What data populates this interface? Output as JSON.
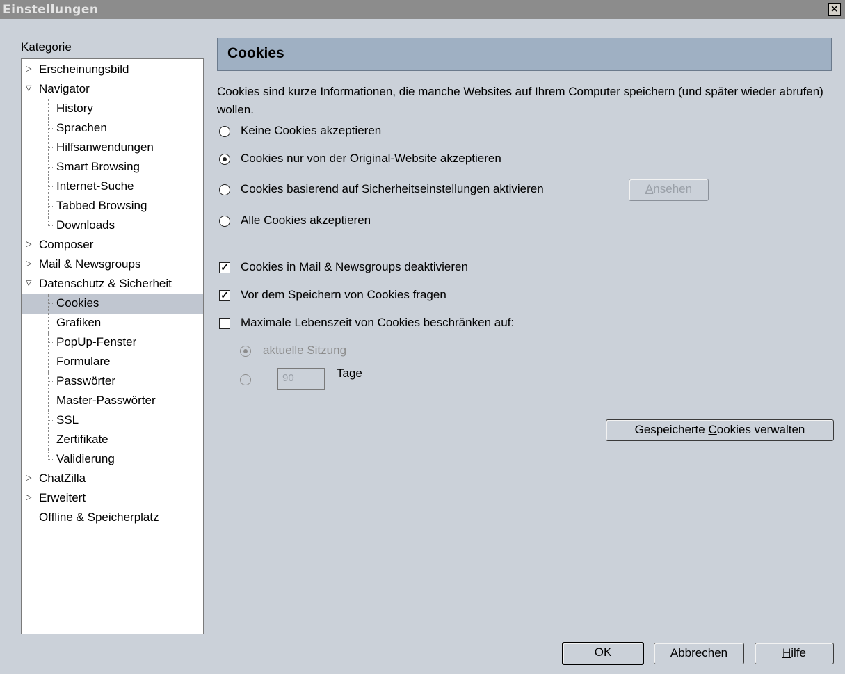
{
  "window": {
    "title": "Einstellungen",
    "close_glyph": "×"
  },
  "sidebar": {
    "label": "Kategorie",
    "items": [
      {
        "label": "Erscheinungsbild",
        "level": 0,
        "twisty": "closed"
      },
      {
        "label": "Navigator",
        "level": 0,
        "twisty": "open"
      },
      {
        "label": "History",
        "level": 1
      },
      {
        "label": "Sprachen",
        "level": 1
      },
      {
        "label": "Hilfsanwendungen",
        "level": 1
      },
      {
        "label": "Smart Browsing",
        "level": 1
      },
      {
        "label": "Internet-Suche",
        "level": 1
      },
      {
        "label": "Tabbed Browsing",
        "level": 1
      },
      {
        "label": "Downloads",
        "level": 1
      },
      {
        "label": "Composer",
        "level": 0,
        "twisty": "closed"
      },
      {
        "label": "Mail & Newsgroups",
        "level": 0,
        "twisty": "closed"
      },
      {
        "label": "Datenschutz & Sicherheit",
        "level": 0,
        "twisty": "open"
      },
      {
        "label": "Cookies",
        "level": 1,
        "selected": true
      },
      {
        "label": "Grafiken",
        "level": 1
      },
      {
        "label": "PopUp-Fenster",
        "level": 1
      },
      {
        "label": "Formulare",
        "level": 1
      },
      {
        "label": "Passwörter",
        "level": 1
      },
      {
        "label": "Master-Passwörter",
        "level": 1
      },
      {
        "label": "SSL",
        "level": 1
      },
      {
        "label": "Zertifikate",
        "level": 1
      },
      {
        "label": "Validierung",
        "level": 1
      },
      {
        "label": "ChatZilla",
        "level": 0,
        "twisty": "closed"
      },
      {
        "label": "Erweitert",
        "level": 0,
        "twisty": "closed"
      },
      {
        "label": "Offline & Speicherplatz",
        "level": 0,
        "twisty": "none"
      }
    ]
  },
  "pane": {
    "title": "Cookies",
    "description": "Cookies sind kurze Informationen, die manche Websites auf Ihrem Computer speichern (und später wieder abrufen) wollen.",
    "radios": [
      {
        "label": "Keine Cookies akzeptieren",
        "checked": false
      },
      {
        "label": "Cookies nur von der Original-Website akzeptieren",
        "checked": true
      },
      {
        "label": "Cookies basierend auf Sicherheitseinstellungen aktivieren",
        "checked": false
      },
      {
        "label": "Alle Cookies akzeptieren",
        "checked": false
      }
    ],
    "view_button": {
      "label": "Ansehen",
      "mnemonic_index": 0,
      "enabled": false
    },
    "checkboxes": [
      {
        "label": "Cookies in Mail & Newsgroups deaktivieren",
        "checked": true
      },
      {
        "label": "Vor dem Speichern von Cookies fragen",
        "checked": true
      },
      {
        "label": "Maximale Lebenszeit von Cookies beschränken auf:",
        "checked": false
      }
    ],
    "lifetime": {
      "session_label": "aktuelle Sitzung",
      "session_checked": true,
      "days_value": "90",
      "days_label": "Tage"
    },
    "manage_button": {
      "label_pre": "Gespeicherte ",
      "mnemonic": "C",
      "label_post": "ookies verwalten"
    }
  },
  "footer": {
    "ok": "OK",
    "cancel": "Abbrechen",
    "help_mnemonic": "H",
    "help_rest": "ilfe"
  },
  "colors": {
    "background": "#cbd1d9",
    "header": "#9fb0c3",
    "selection": "#c0c6d0",
    "titlebar": "#8c8c8c"
  }
}
